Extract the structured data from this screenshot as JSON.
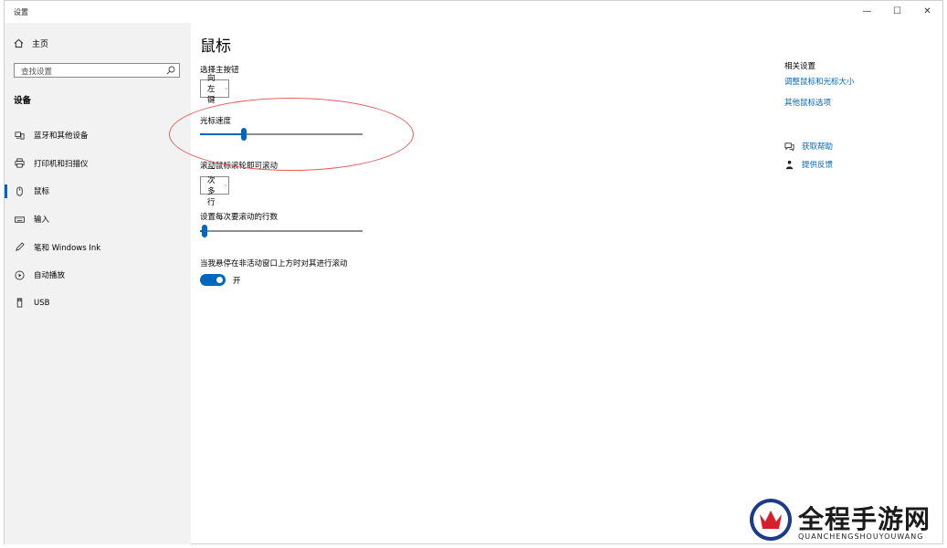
{
  "window": {
    "title": "设置",
    "controls": {
      "minimize": "—",
      "maximize": "☐",
      "close": "✕"
    }
  },
  "sidebar": {
    "home_label": "主页",
    "search": {
      "placeholder": "查找设置"
    },
    "section_title": "设备",
    "items": [
      {
        "label": "蓝牙和其他设备",
        "icon": "bluetooth-devices-icon"
      },
      {
        "label": "打印机和扫描仪",
        "icon": "printer-icon"
      },
      {
        "label": "鼠标",
        "icon": "mouse-icon",
        "active": true
      },
      {
        "label": "输入",
        "icon": "keyboard-icon"
      },
      {
        "label": "笔和 Windows Ink",
        "icon": "pen-icon"
      },
      {
        "label": "自动播放",
        "icon": "autoplay-icon"
      },
      {
        "label": "USB",
        "icon": "usb-icon"
      }
    ]
  },
  "main": {
    "title": "鼠标",
    "primary_button": {
      "label": "选择主按钮",
      "value": "向左键"
    },
    "cursor_speed": {
      "label": "光标速度",
      "level": 0.27
    },
    "scroll_wheel": {
      "label": "滚动鼠标滚轮即可滚动",
      "value": "一次多行"
    },
    "lines_to_scroll": {
      "label": "设置每次要滚动的行数",
      "level": 0.03
    },
    "inactive_scroll": {
      "label": "当我悬停在非活动窗口上方时对其进行滚动",
      "state": "开",
      "on": true
    }
  },
  "related": {
    "title": "相关设置",
    "links": [
      "调整鼠标和光标大小",
      "其他鼠标选项"
    ]
  },
  "help": {
    "get_help": "获取帮助",
    "feedback": "提供反馈"
  },
  "watermark": {
    "name": "全程手游网",
    "subtitle": "QUANCHENGSHOUYOUWANG"
  },
  "colors": {
    "accent": "#0067c0",
    "annotation": "#e55b5b"
  }
}
